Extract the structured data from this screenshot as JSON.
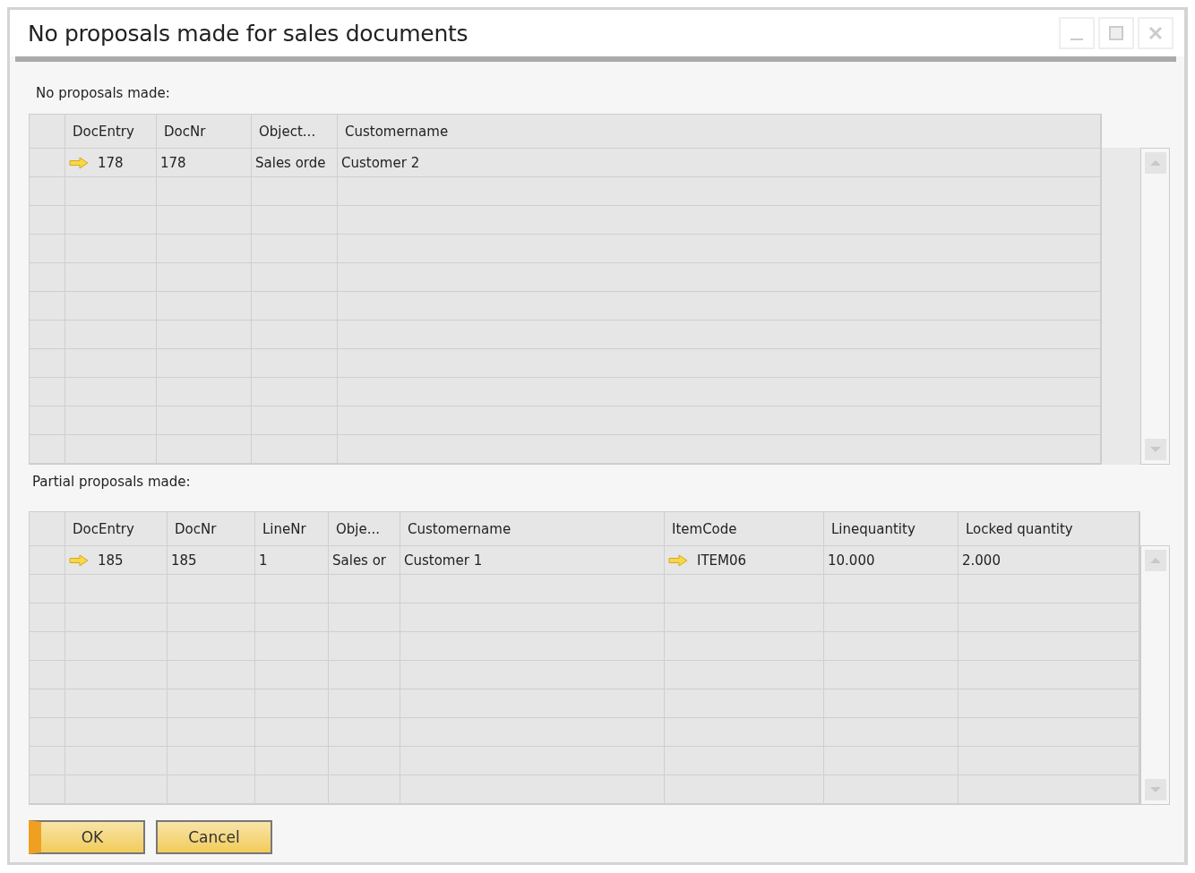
{
  "window": {
    "title": "No proposals made for sales documents"
  },
  "sections": [
    {
      "label": "No proposals made:",
      "columns": [
        "DocEntry",
        "DocNr",
        "Object...",
        "Customername"
      ],
      "rows": [
        {
          "cells": [
            {
              "text": "178",
              "link": true
            },
            {
              "text": "178",
              "link": false
            },
            {
              "text": "Sales orde",
              "link": false
            },
            {
              "text": "Customer 2",
              "link": false
            }
          ]
        }
      ]
    },
    {
      "label": "Partial proposals made:",
      "columns": [
        "DocEntry",
        "DocNr",
        "LineNr",
        "Obje...",
        "Customername",
        "ItemCode",
        "Linequantity",
        "Locked quantity"
      ],
      "rows": [
        {
          "cells": [
            {
              "text": "185",
              "link": true
            },
            {
              "text": "185",
              "link": false
            },
            {
              "text": "1",
              "link": false
            },
            {
              "text": "Sales or",
              "link": false
            },
            {
              "text": "Customer 1",
              "link": false
            },
            {
              "text": "ITEM06",
              "link": true
            },
            {
              "text": "10.000",
              "link": false
            },
            {
              "text": "2.000",
              "link": false
            }
          ]
        }
      ]
    }
  ],
  "buttons": [
    {
      "label": "OK",
      "default": true
    },
    {
      "label": "Cancel",
      "default": false
    }
  ]
}
